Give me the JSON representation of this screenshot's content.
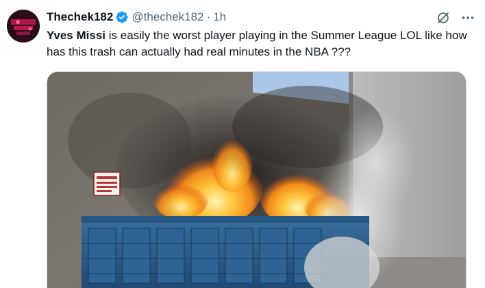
{
  "author": {
    "display_name": "Thechek182",
    "handle": "@thechek182",
    "separator": "·",
    "time": "1h",
    "verified": true
  },
  "post": {
    "mention": "Yves Missi",
    "body": " is easily the worst player playing in the Summer League LOL like how has this trash can actually had real minutes in the NBA ???"
  },
  "media": {
    "type": "video-still",
    "sign_text": "NO DUMPING"
  },
  "colors": {
    "text": "#0f1419",
    "secondary": "#536471",
    "verified_blue": "#1d9bf0",
    "dumpster_blue": "#2b5d8a",
    "fire": "#f7a21b"
  },
  "icons": {
    "verified": "verified-badge-icon",
    "grok": "grok-icon",
    "more": "more-options-icon"
  }
}
